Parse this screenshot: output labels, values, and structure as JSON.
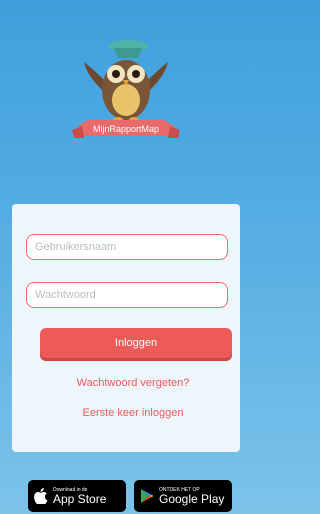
{
  "brand": {
    "banner_text": "MijnRapportMap"
  },
  "login": {
    "username_placeholder": "Gebruikersnaam",
    "password_placeholder": "Wachtwoord",
    "login_button": "Inloggen",
    "forgot_password": "Wachtwoord vergeten?",
    "first_login": "Eerste keer inloggen"
  },
  "stores": {
    "apple": {
      "small": "Download in de",
      "big": "App Store"
    },
    "google": {
      "small": "ONTDEK HET OP",
      "big": "Google Play"
    }
  },
  "colors": {
    "background": "#4aa6df",
    "accent": "#ec5b57",
    "card": "#eef6fb"
  }
}
